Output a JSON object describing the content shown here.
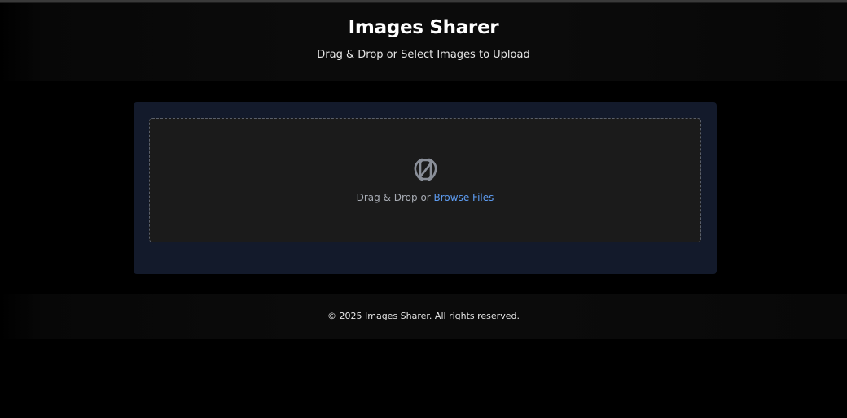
{
  "header": {
    "title": "Images Sharer",
    "subtitle": "Drag & Drop or Select Images to Upload"
  },
  "dropzone": {
    "icon": "image-upload-icon",
    "prompt_text": "Drag & Drop or ",
    "browse_label": "Browse Files"
  },
  "footer": {
    "copyright": "© 2025 Images Sharer. All rights reserved."
  },
  "colors": {
    "background": "#000000",
    "panel": "#131a2b",
    "dropzone": "#1b1b1b",
    "link": "#5d9bf0"
  }
}
